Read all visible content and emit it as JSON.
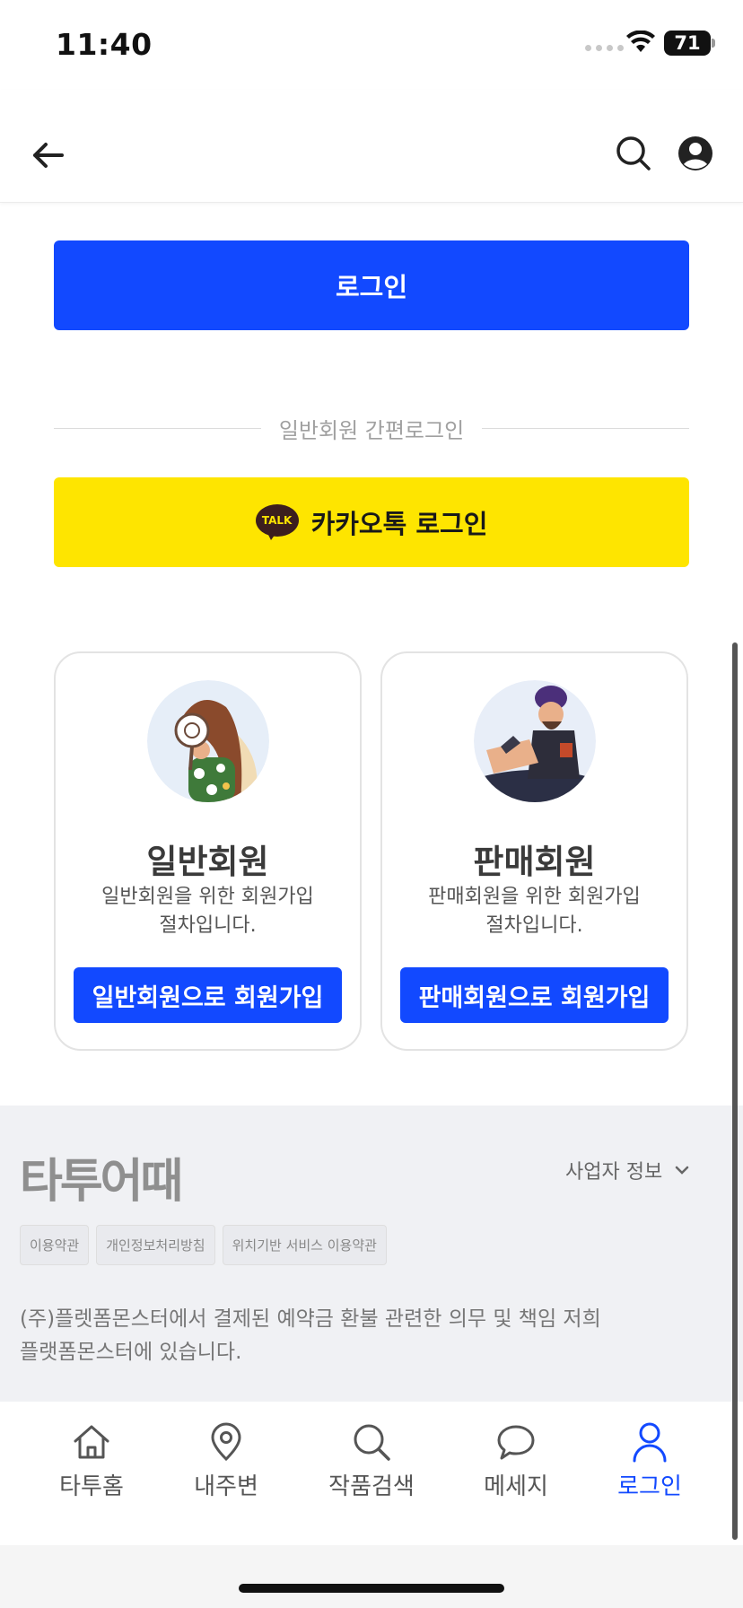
{
  "status_bar": {
    "time": "11:40",
    "battery": "71"
  },
  "auth": {
    "login_label": "로그인",
    "divider_text": "일반회원 간편로그인",
    "kakao_label": "카카오톡 로그인",
    "kakao_icon_text": "TALK"
  },
  "cards": [
    {
      "title": "일반회원",
      "description_line1": "일반회원을 위한 회원가입",
      "description_line2": "절차입니다.",
      "button_label": "일반회원으로 회원가입",
      "avatar_icon": "magnifier-woman-illustration"
    },
    {
      "title": "판매회원",
      "description_line1": "판매회원을 위한 회원가입",
      "description_line2": "절차입니다.",
      "button_label": "판매회원으로 회원가입",
      "avatar_icon": "tattoo-artist-illustration"
    }
  ],
  "footer": {
    "logo": "타투어때",
    "business_info_label": "사업자 정보",
    "links": [
      "이용약관",
      "개인정보처리방침",
      "위치기반 서비스 이용약관"
    ],
    "notice_line1": "(주)플렛폼몬스터에서 결제된 예약금 환불 관련한 의무 및 책임 저희",
    "notice_line2": "플랫폼몬스터에 있습니다."
  },
  "tabs": [
    {
      "label": "타투홈",
      "icon": "home-icon"
    },
    {
      "label": "내주변",
      "icon": "location-pin-icon"
    },
    {
      "label": "작품검색",
      "icon": "search-icon"
    },
    {
      "label": "메세지",
      "icon": "chat-bubble-icon"
    },
    {
      "label": "로그인",
      "icon": "person-icon",
      "active": true
    }
  ],
  "colors": {
    "primary": "#1249ff",
    "kakao": "#fee500",
    "footer_bg": "#f0f1f4"
  }
}
